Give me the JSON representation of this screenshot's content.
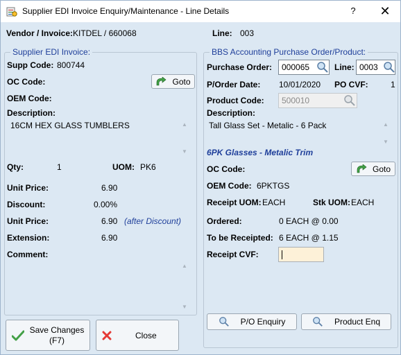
{
  "window": {
    "title": "Supplier EDI Invoice Enquiry/Maintenance - Line Details",
    "help": "?",
    "close": "✕"
  },
  "header": {
    "vendor_label": "Vendor / Invoice:",
    "vendor_value": "KITDEL / 660068",
    "line_label": "Line:",
    "line_value": "003"
  },
  "supplier": {
    "group_title": "Supplier EDI Invoice:",
    "supp_code_label": "Supp Code:",
    "supp_code_value": "800744",
    "oc_code_label": "OC Code:",
    "goto_label": "Goto",
    "oem_code_label": "OEM Code:",
    "description_label": "Description:",
    "description_value": "16CM HEX GLASS TUMBLERS",
    "qty_label": "Qty:",
    "qty_value": "1",
    "uom_label": "UOM:",
    "uom_value": "PK6",
    "unit_price_label": "Unit Price:",
    "unit_price_value": "6.90",
    "discount_label": "Discount:",
    "discount_value": "0.00%",
    "unit_price2_label": "Unit Price:",
    "unit_price2_value": "6.90",
    "after_discount": "(after Discount)",
    "extension_label": "Extension:",
    "extension_value": "6.90",
    "comment_label": "Comment:"
  },
  "bbs": {
    "group_title": "BBS Accounting Purchase Order/Product:",
    "po_label": "Purchase Order:",
    "po_value": "000065",
    "line_label": "Line:",
    "line_value": "0003",
    "porder_date_label": "P/Order Date:",
    "porder_date_value": "10/01/2020",
    "po_cvf_label": "PO CVF:",
    "po_cvf_value": "1",
    "product_code_label": "Product Code:",
    "product_code_value": "500010",
    "description_label": "Description:",
    "description_value": "Tall Glass Set - Metalic - 6 Pack",
    "product_name": "6PK Glasses - Metalic Trim",
    "oc_code_label": "OC Code:",
    "goto_label": "Goto",
    "oem_code_label": "OEM Code:",
    "oem_code_value": "6PKTGS",
    "receipt_uom_label": "Receipt UOM:",
    "receipt_uom_value": "EACH",
    "stk_uom_label": "Stk UOM:",
    "stk_uom_value": "EACH",
    "ordered_label": "Ordered:",
    "ordered_value": "0 EACH @ 0.00",
    "to_be_receipted_label": "To be Receipted:",
    "to_be_receipted_value": "6 EACH @ 1.15",
    "receipt_cvf_label": "Receipt CVF:",
    "receipt_cvf_value": "",
    "po_enquiry_label": "P/O Enquiry",
    "product_enq_label": "Product Enq"
  },
  "footer": {
    "save_line1": "Save Changes",
    "save_line2": "(F7)",
    "close_label": "Close"
  }
}
